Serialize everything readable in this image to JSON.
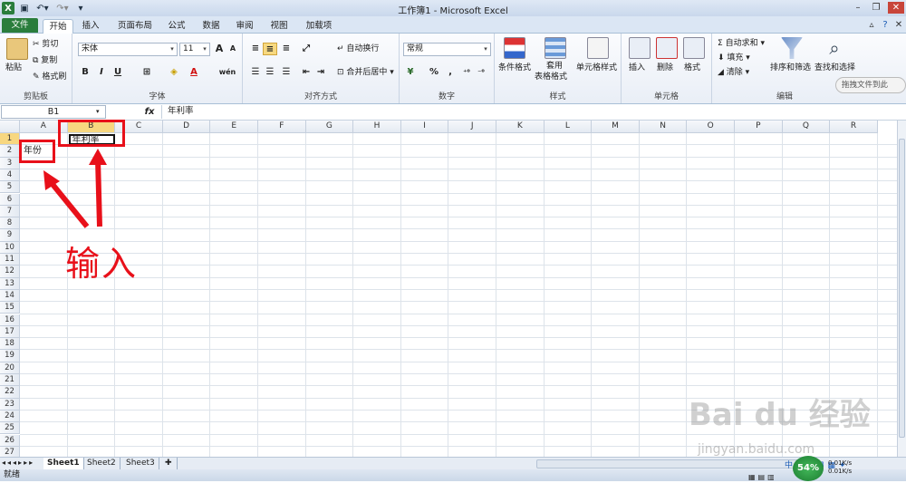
{
  "window": {
    "title": "工作簿1 - Microsoft Excel"
  },
  "tabs": [
    "文件",
    "开始",
    "插入",
    "页面布局",
    "公式",
    "数据",
    "审阅",
    "视图",
    "加载项"
  ],
  "ribbon": {
    "clipboard": {
      "label": "剪贴板",
      "paste": "粘贴",
      "cut": "剪切",
      "copy": "复制",
      "format_painter": "格式刷"
    },
    "font": {
      "label": "字体",
      "name": "宋体",
      "size": "11",
      "bold": "B",
      "italic": "I",
      "underline": "U",
      "grow": "A",
      "shrink": "A",
      "color_a": "A",
      "wen": "wén"
    },
    "alignment": {
      "label": "对齐方式",
      "wrap": "自动换行",
      "merge": "合并后居中"
    },
    "number": {
      "label": "数字",
      "format": "常规",
      "percent": "%",
      "comma": ","
    },
    "styles": {
      "label": "样式",
      "conditional": "条件格式",
      "table_l1": "套用",
      "table_l2": "表格格式",
      "cell_styles": "单元格样式"
    },
    "cells": {
      "label": "单元格",
      "insert": "插入",
      "delete": "删除",
      "format": "格式"
    },
    "editing": {
      "label": "编辑",
      "autosum": "自动求和",
      "fill": "填充",
      "clear": "清除",
      "sort": "排序和筛选",
      "find": "查找和选择"
    },
    "drag_hint": "拖拽文件到此"
  },
  "formula_bar": {
    "name_box": "B1",
    "fx": "fx",
    "content": "年利率"
  },
  "columns": [
    "A",
    "B",
    "C",
    "D",
    "E",
    "F",
    "G",
    "H",
    "I",
    "J",
    "K",
    "L",
    "M",
    "N",
    "O",
    "P",
    "Q",
    "R"
  ],
  "rows": [
    "1",
    "2",
    "3",
    "4",
    "5",
    "6",
    "7",
    "8",
    "9",
    "10",
    "11",
    "12",
    "13",
    "14",
    "15",
    "16",
    "17",
    "18",
    "19",
    "20",
    "21",
    "22",
    "23",
    "24",
    "25",
    "26",
    "27"
  ],
  "cells": {
    "A2": "年份",
    "B1": "年利率"
  },
  "annotation": {
    "text": "输入"
  },
  "sheets": [
    "Sheet1",
    "Sheet2",
    "Sheet3"
  ],
  "status": {
    "ready": "就绪",
    "zoom": "54%",
    "up_speed": "0.01K/s",
    "down_speed": "0.01K/s"
  },
  "watermark": {
    "line1": "Bai du 经验",
    "line2": "jingyan.baidu.com"
  }
}
